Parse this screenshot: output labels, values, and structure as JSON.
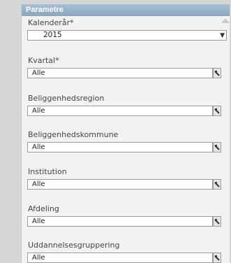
{
  "panel": {
    "title": "Parametre"
  },
  "fields": [
    {
      "label": "Kalenderår*",
      "value": "2015"
    },
    {
      "label": "Kvartal*",
      "value": "Alle"
    },
    {
      "label": "Beliggenhedsregion",
      "value": "Alle"
    },
    {
      "label": "Beliggenhedskommune",
      "value": "Alle"
    },
    {
      "label": "Institution",
      "value": "Alle"
    },
    {
      "label": "Afdeling",
      "value": "Alle"
    },
    {
      "label": "Uddannelsesgruppering",
      "value": "Alle"
    }
  ],
  "icons": {
    "year_dropdown": "triangle-down",
    "multi_select": "dropdown-button"
  }
}
